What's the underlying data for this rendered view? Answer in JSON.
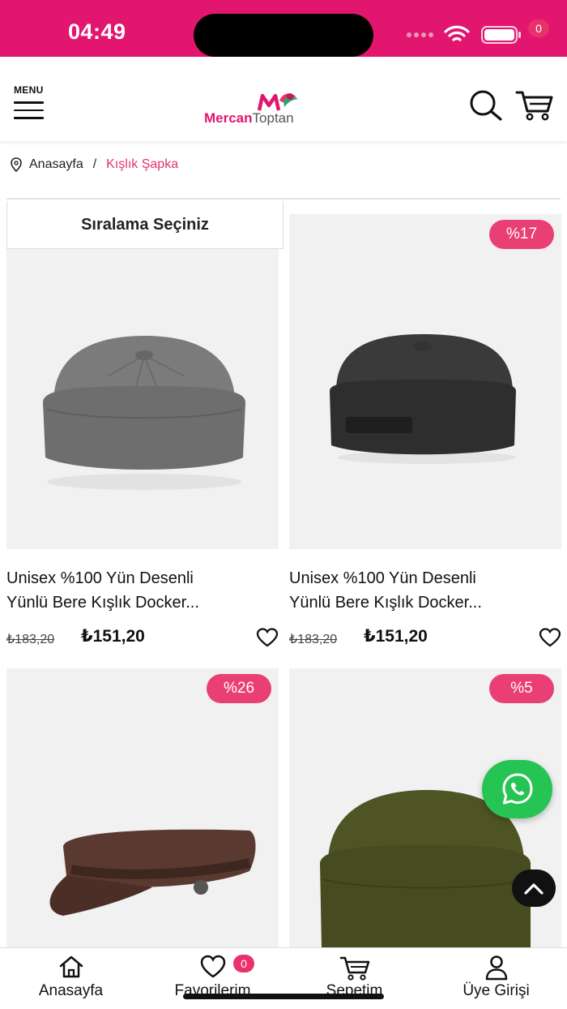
{
  "status_bar": {
    "time": "04:49"
  },
  "header": {
    "menu_label": "MENU",
    "logo_part1": "Mercan",
    "logo_part2": "Toptan",
    "cart_count": "0"
  },
  "breadcrumb": {
    "home": "Anasayfa",
    "separator": "/",
    "current": "Kışlık Şapka"
  },
  "sort": {
    "label": "Sıralama Seçiniz"
  },
  "products": [
    {
      "title_line1": "Unisex %100 Yün Desenli",
      "title_line2": "Yünlü Bere Kışlık Docker...",
      "old_price": "₺183,20",
      "price": "₺151,20",
      "discount": "",
      "hat_color": "#7b7b7b"
    },
    {
      "title_line1": "Unisex %100 Yün Desenli",
      "title_line2": "Yünlü Bere Kışlık Docker...",
      "old_price": "₺183,20",
      "price": "₺151,20",
      "discount": "%17",
      "hat_color": "#3a3a3b"
    },
    {
      "discount": "%26",
      "hat_color": "#5a3a30"
    },
    {
      "discount": "%5",
      "hat_color": "#4f5424"
    }
  ],
  "bottom_nav": {
    "home": "Anasayfa",
    "favorites": "Favorilerim",
    "favorites_count": "0",
    "cart": "Sepetim",
    "login": "Üye Girişi"
  },
  "colors": {
    "brand": "#e2156f",
    "badge": "#ea3f74",
    "whatsapp": "#26c453"
  },
  "icons": [
    "menu-icon",
    "search-icon",
    "cart-icon",
    "location-pin-icon",
    "heart-icon",
    "whatsapp-icon",
    "chevron-up-icon",
    "home-icon",
    "user-icon"
  ]
}
